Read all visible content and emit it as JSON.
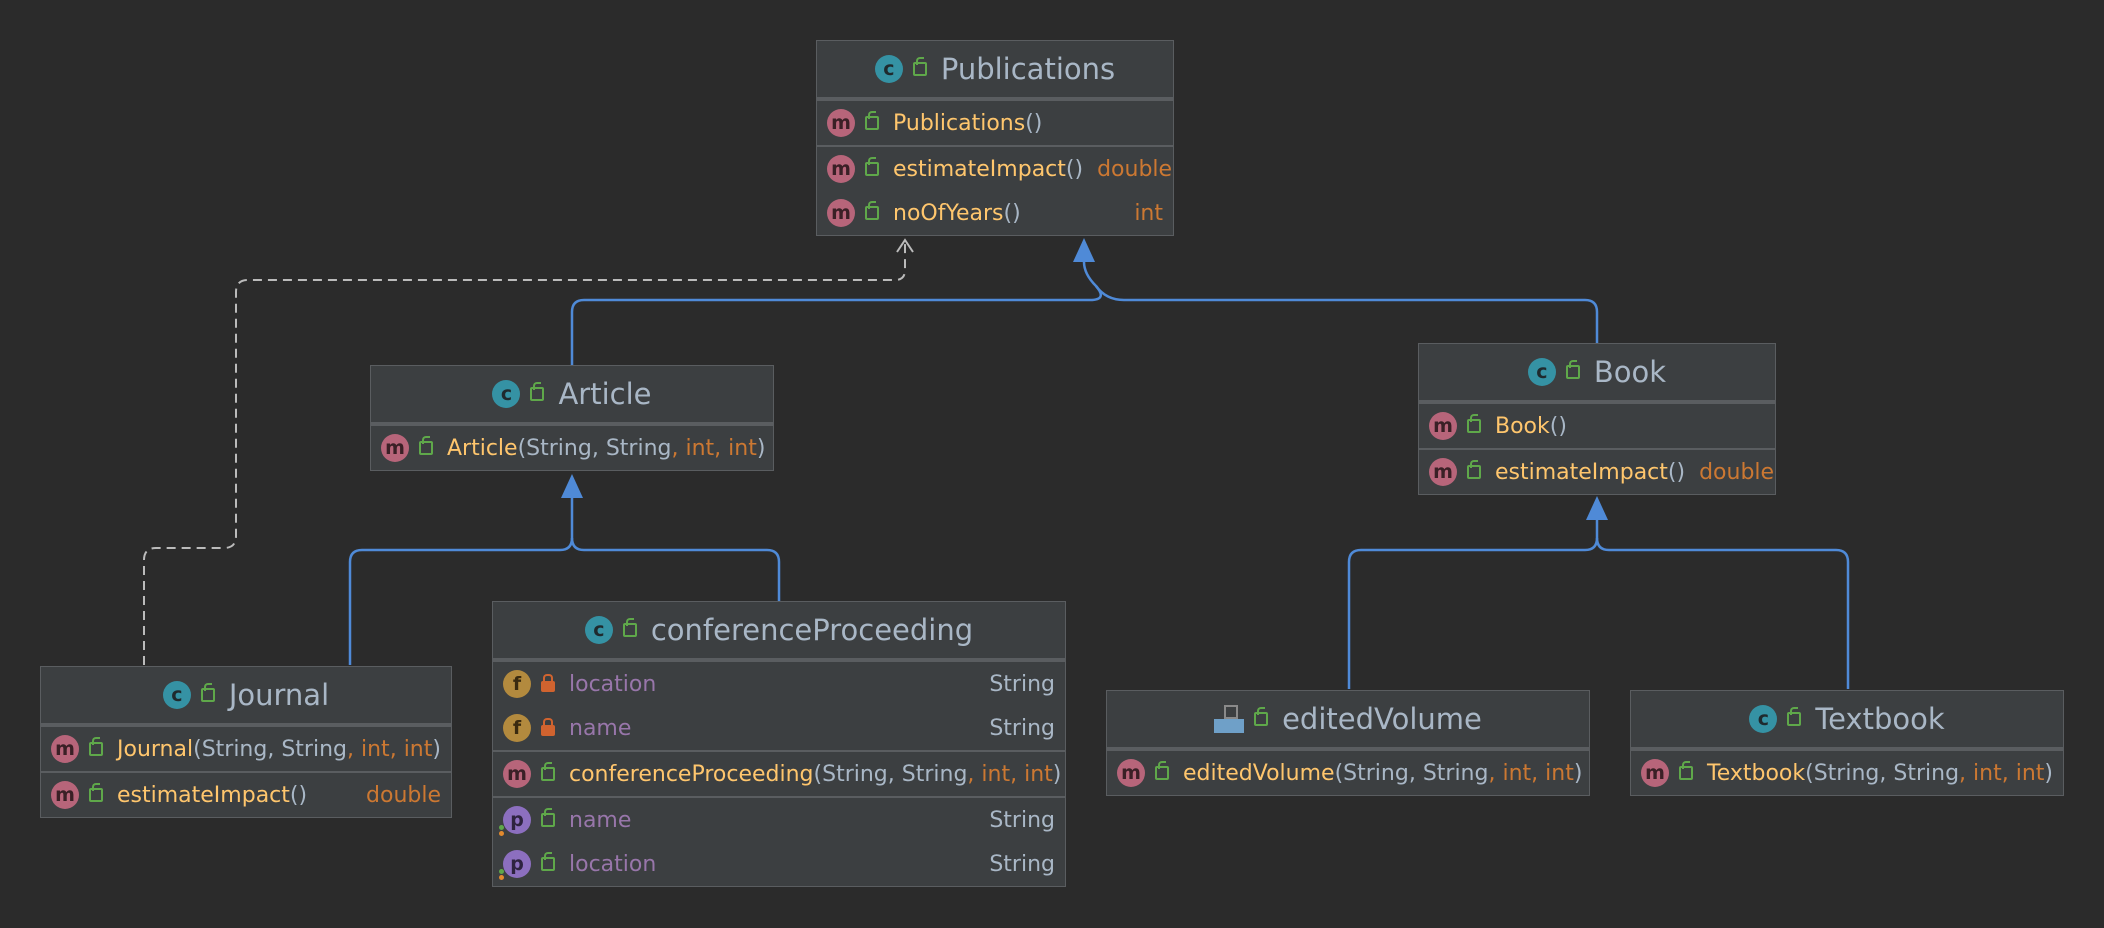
{
  "colors": {
    "background": "#2b2b2b",
    "node_fill": "#3c3f41",
    "node_border": "#5a5d60",
    "inheritance_edge": "#4f8ad7",
    "dependency_edge": "#bbbbbb",
    "method_name": "#ffc66d",
    "field_name": "#9876aa",
    "primitive_type": "#cc7832"
  },
  "classes": {
    "publications": {
      "icon": "class-icon",
      "name": "Publications",
      "constructor": {
        "name": "Publications",
        "open": "(",
        "close": ")"
      },
      "methods": [
        {
          "name": "estimateImpact",
          "parens": "()",
          "return": "double"
        },
        {
          "name": "noOfYears",
          "parens": "()",
          "return": "int"
        }
      ]
    },
    "article": {
      "icon": "class-icon",
      "name": "Article",
      "constructor": {
        "name": "Article",
        "open": "(",
        "p1": "String",
        "s1": ", ",
        "p2": "String",
        "s2": ", ",
        "p3": "int",
        "s3": ", ",
        "p4": "int",
        "close": ")"
      }
    },
    "book": {
      "icon": "class-icon",
      "name": "Book",
      "constructor": {
        "name": "Book",
        "open": "(",
        "close": ")"
      },
      "methods": [
        {
          "name": "estimateImpact",
          "parens": "()",
          "return": "double"
        }
      ]
    },
    "journal": {
      "icon": "class-icon",
      "name": "Journal",
      "constructor": {
        "name": "Journal",
        "open": "(",
        "p1": "String",
        "s1": ", ",
        "p2": "String",
        "s2": ", ",
        "p3": "int",
        "s3": ", ",
        "p4": "int",
        "close": ")"
      },
      "methods": [
        {
          "name": "estimateImpact",
          "parens": "()",
          "return": "double"
        }
      ]
    },
    "conference": {
      "icon": "class-icon",
      "name": "conferenceProceeding",
      "fields": [
        {
          "name": "location",
          "type": "String"
        },
        {
          "name": "name",
          "type": "String"
        }
      ],
      "constructor": {
        "name": "conferenceProceeding",
        "open": "(",
        "p1": "String",
        "s1": ", ",
        "p2": "String",
        "s2": ", ",
        "p3": "int",
        "s3": ", ",
        "p4": "int",
        "close": ")"
      },
      "properties": [
        {
          "name": "name",
          "type": "String"
        },
        {
          "name": "location",
          "type": "String"
        }
      ]
    },
    "edited": {
      "icon": "enum-icon",
      "name": "editedVolume",
      "constructor": {
        "name": "editedVolume",
        "open": "(",
        "p1": "String",
        "s1": ", ",
        "p2": "String",
        "s2": ", ",
        "p3": "int",
        "s3": ", ",
        "p4": "int",
        "close": ")"
      }
    },
    "textbook": {
      "icon": "class-icon",
      "name": "Textbook",
      "constructor": {
        "name": "Textbook",
        "open": "(",
        "p1": "String",
        "s1": ", ",
        "p2": "String",
        "s2": ", ",
        "p3": "int",
        "s3": ", ",
        "p4": "int",
        "close": ")"
      }
    }
  },
  "badges": {
    "class": "c",
    "method": "m",
    "field": "f",
    "property": "p"
  },
  "relations": [
    {
      "from": "Article",
      "to": "Publications",
      "kind": "inheritance"
    },
    {
      "from": "Book",
      "to": "Publications",
      "kind": "inheritance"
    },
    {
      "from": "Journal",
      "to": "Article",
      "kind": "inheritance"
    },
    {
      "from": "conferenceProceeding",
      "to": "Article",
      "kind": "inheritance"
    },
    {
      "from": "editedVolume",
      "to": "Book",
      "kind": "inheritance"
    },
    {
      "from": "Textbook",
      "to": "Book",
      "kind": "inheritance"
    },
    {
      "from": "Journal",
      "to": "Publications",
      "kind": "dependency"
    }
  ]
}
